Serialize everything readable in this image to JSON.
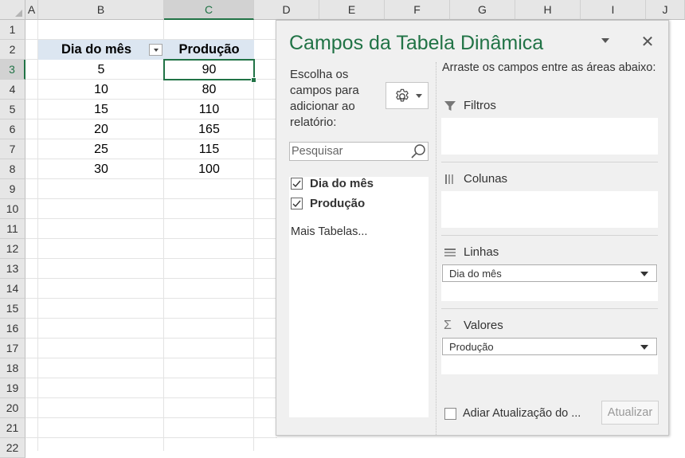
{
  "sheet": {
    "columns": [
      "A",
      "B",
      "C",
      "D",
      "E",
      "F",
      "G",
      "H",
      "I",
      "J"
    ],
    "rows": [
      "1",
      "2",
      "3",
      "4",
      "5",
      "6",
      "7",
      "8",
      "9",
      "10",
      "11",
      "12",
      "13",
      "14",
      "15",
      "16",
      "17",
      "18",
      "19",
      "20",
      "21",
      "22"
    ],
    "selected_column": "C",
    "selected_row": "3",
    "table": {
      "header_day": "Dia do mês",
      "header_production": "Produção",
      "rows": [
        {
          "day": "5",
          "production": "90"
        },
        {
          "day": "10",
          "production": "80"
        },
        {
          "day": "15",
          "production": "110"
        },
        {
          "day": "20",
          "production": "165"
        },
        {
          "day": "25",
          "production": "115"
        },
        {
          "day": "30",
          "production": "100"
        }
      ]
    }
  },
  "pivot_pane": {
    "title": "Campos da Tabela Dinâmica",
    "choose_fields": "Escolha os campos para adicionar ao relatório:",
    "search_placeholder": "Pesquisar",
    "fields": [
      {
        "label": "Dia do mês",
        "checked": true
      },
      {
        "label": "Produção",
        "checked": true
      }
    ],
    "more_tables": "Mais Tabelas...",
    "drag_instruction": "Arraste os campos entre as áreas abaixo:",
    "areas": {
      "filters": {
        "label": "Filtros",
        "icon": "filter-icon"
      },
      "columns": {
        "label": "Colunas",
        "icon": "columns-icon"
      },
      "rows": {
        "label": "Linhas",
        "icon": "rows-icon",
        "field": "Dia do mês"
      },
      "values": {
        "label": "Valores",
        "icon": "sigma-icon",
        "field": "Produção"
      }
    },
    "defer_update": "Adiar Atualização do ...",
    "update_button": "Atualizar"
  },
  "colors": {
    "accent_green": "#217346",
    "header_fill": "#dce6f1",
    "pane_bg": "#f0f0f0"
  }
}
